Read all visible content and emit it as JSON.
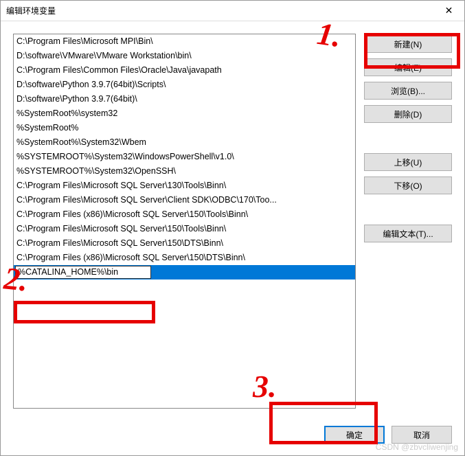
{
  "dialog": {
    "title": "编辑环境变量"
  },
  "list": {
    "items": [
      "C:\\Program Files\\Microsoft MPI\\Bin\\",
      "D:\\software\\VMware\\VMware Workstation\\bin\\",
      "C:\\Program Files\\Common Files\\Oracle\\Java\\javapath",
      "D:\\software\\Python 3.9.7(64bit)\\Scripts\\",
      "D:\\software\\Python 3.9.7(64bit)\\",
      "%SystemRoot%\\system32",
      "%SystemRoot%",
      "%SystemRoot%\\System32\\Wbem",
      "%SYSTEMROOT%\\System32\\WindowsPowerShell\\v1.0\\",
      "%SYSTEMROOT%\\System32\\OpenSSH\\",
      "C:\\Program Files\\Microsoft SQL Server\\130\\Tools\\Binn\\",
      "C:\\Program Files\\Microsoft SQL Server\\Client SDK\\ODBC\\170\\Too...",
      "C:\\Program Files (x86)\\Microsoft SQL Server\\150\\Tools\\Binn\\",
      "C:\\Program Files\\Microsoft SQL Server\\150\\Tools\\Binn\\",
      "C:\\Program Files\\Microsoft SQL Server\\150\\DTS\\Binn\\",
      "C:\\Program Files (x86)\\Microsoft SQL Server\\150\\DTS\\Binn\\",
      "%CATALINA_HOME%\\bin"
    ],
    "selected_index": 16,
    "editing_value": "%CATALINA_HOME%\\bin"
  },
  "buttons": {
    "new": "新建(N)",
    "edit": "编辑(E)",
    "browse": "浏览(B)...",
    "delete": "删除(D)",
    "move_up": "上移(U)",
    "move_down": "下移(O)",
    "edit_text": "编辑文本(T)...",
    "ok": "确定",
    "cancel": "取消"
  },
  "annotations": {
    "label1": "1.",
    "label2": "2.",
    "label3": "3."
  },
  "watermark": "CSDN @zbvcliwenjing"
}
